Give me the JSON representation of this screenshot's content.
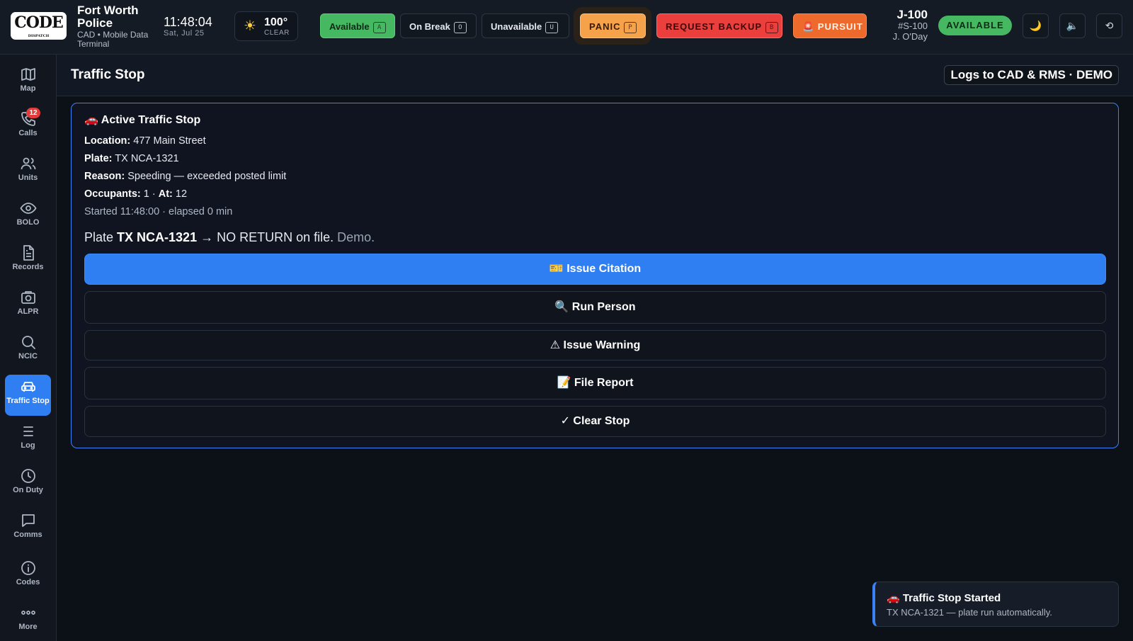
{
  "app": {
    "logo_text": "CODE",
    "logo_sub": "DISPATCH",
    "agency_name": "Fort Worth Police",
    "agency_sub": "CAD • Mobile Data Terminal",
    "time": "11:48:04",
    "date": "Sat, Jul 25"
  },
  "weather": {
    "icon": "sun-icon",
    "temp": "100°",
    "condition": "CLEAR"
  },
  "status_buttons": {
    "available": {
      "label": "Available",
      "key": "A"
    },
    "on_break": {
      "label": "On Break",
      "key": "O"
    },
    "unavailable": {
      "label": "Unavailable",
      "key": "U"
    },
    "panic": {
      "label": "PANIC",
      "key": "P"
    },
    "backup": {
      "label": "REQUEST BACKUP",
      "key": "B"
    },
    "pursuit": {
      "label": "🚨 PURSUIT"
    }
  },
  "unit": {
    "callsign": "J-100",
    "badge": "#S-100",
    "officer": "J. O'Day",
    "status": "AVAILABLE"
  },
  "header_icons": {
    "theme": "🌙",
    "mute": "🔈",
    "history": "⟲"
  },
  "sidebar": {
    "items": [
      {
        "label": "Map",
        "icon": "map-icon"
      },
      {
        "label": "Calls",
        "icon": "phone-icon",
        "badge": "12"
      },
      {
        "label": "Units",
        "icon": "users-icon"
      },
      {
        "label": "BOLO",
        "icon": "eye-icon"
      },
      {
        "label": "Records",
        "icon": "document-icon"
      },
      {
        "label": "ALPR",
        "icon": "camera-icon"
      },
      {
        "label": "NCIC",
        "icon": "search-icon"
      },
      {
        "label": "Traffic Stop",
        "icon": "car-icon",
        "active": true
      },
      {
        "label": "Log",
        "icon": "list-icon"
      },
      {
        "label": "On Duty",
        "icon": "clock-icon"
      },
      {
        "label": "Comms",
        "icon": "chat-icon"
      },
      {
        "label": "Codes",
        "icon": "info-icon"
      },
      {
        "label": "More",
        "icon": "more-icon"
      }
    ]
  },
  "page": {
    "title": "Traffic Stop",
    "tag": "Logs to CAD & RMS · DEMO"
  },
  "stop": {
    "title": "🚗 Active Traffic Stop",
    "location_label": "Location:",
    "location": "477 Main Street",
    "plate_label": "Plate:",
    "plate": "TX NCA-1321",
    "reason_label": "Reason:",
    "reason": "Speeding — exceeded posted limit",
    "occupants_label": "Occupants:",
    "occupants": "1 ·",
    "at_label": "At:",
    "at": "12",
    "started": "Started 11:48:00 · elapsed 0 min",
    "result_prefix": "Plate",
    "result_plate": "TX NCA-1321",
    "result_text": "→ NO RETURN on file.",
    "result_demo": "Demo."
  },
  "actions": {
    "issue_citation": "🎫 Issue Citation",
    "run_person": "🔍 Run Person",
    "issue_warning": "⚠ Issue Warning",
    "file_report": "📝 File Report",
    "clear_stop": "✓ Clear Stop"
  },
  "toast": {
    "title": "🚗 Traffic Stop Started",
    "body": "TX NCA-1321 — plate run automatically."
  },
  "colors": {
    "accent": "#2f7ff2",
    "available": "#47b862",
    "panic": "#f6a24b",
    "backup": "#ea3f3c",
    "pursuit": "#ee6a2c",
    "badge": "#e23b3b"
  }
}
